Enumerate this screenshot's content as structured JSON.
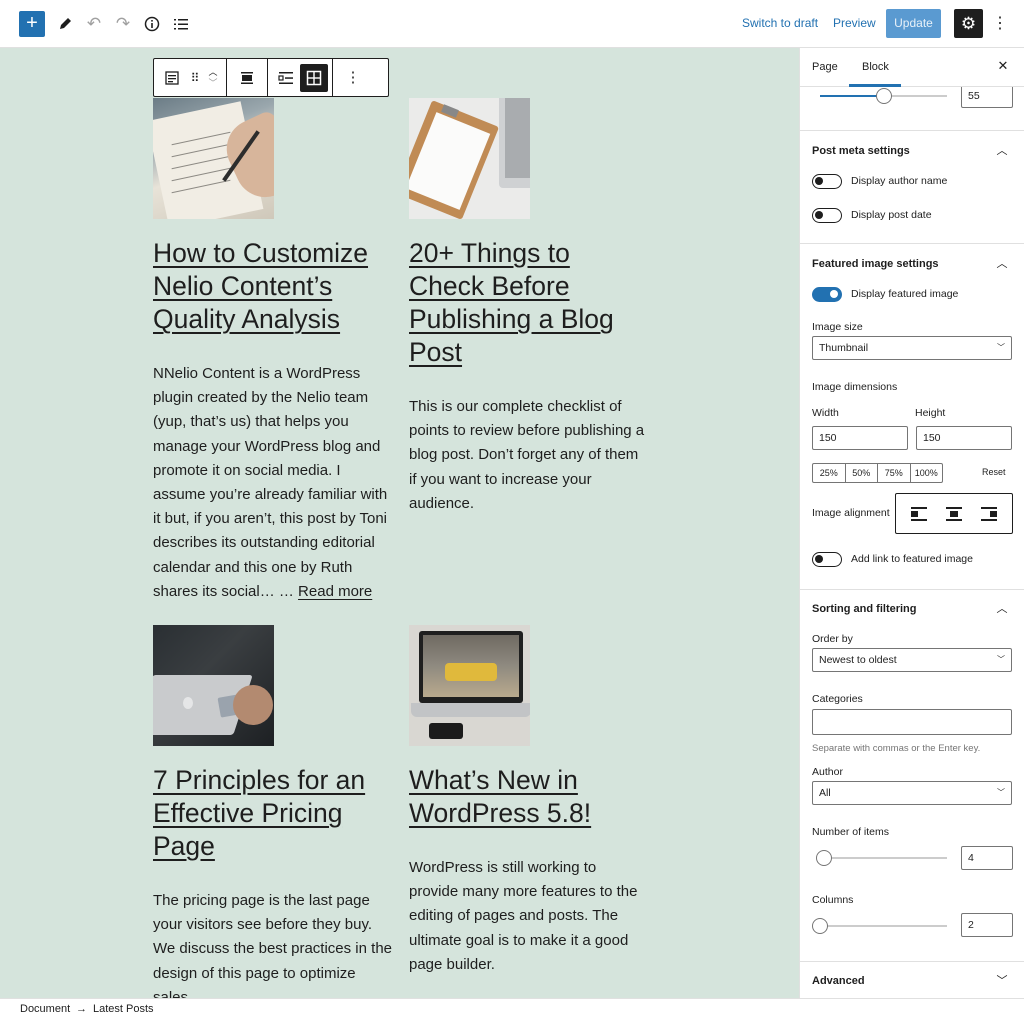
{
  "topbar": {
    "add_block_icon": "plus-icon",
    "tools_icon": "pencil-icon",
    "undo_icon": "undo-icon",
    "redo_icon": "redo-icon",
    "details_icon": "info-icon",
    "outline_icon": "list-view-icon",
    "switch_to_draft": "Switch to draft",
    "preview": "Preview",
    "update": "Update",
    "settings_icon": "gear-icon",
    "more_icon": "kebab-icon"
  },
  "block_toolbar": {
    "block_icon": "latest-posts-icon",
    "drag_icon": "drag-handle-icon",
    "move_icon": "move-up-down-icon",
    "align_icon": "align-wide-icon",
    "list_view_icon": "list-layout-icon",
    "grid_view_icon": "grid-layout-icon",
    "options_icon": "kebab-icon"
  },
  "posts": [
    {
      "title": "How to Customize Nelio Content’s Quality Analysis",
      "excerpt": "NNelio Content is a WordPress plugin created by the Nelio team (yup, that’s us) that helps you manage your WordPress blog and promote it on social media. I assume you’re already familiar with it but, if you aren’t, this post by Toni describes its outstanding editorial calendar and this one by Ruth shares its social… …",
      "read_more": "Read more"
    },
    {
      "title": "20+ Things to Check Before Publishing a Blog Post",
      "excerpt": "This is our complete checklist of points to review before publishing a blog post. Don’t forget any of them if you want to increase your audience.",
      "read_more": ""
    },
    {
      "title": "7 Principles for an Effective Pricing Page",
      "excerpt": "The pricing page is the last page your visitors see before they buy. We discuss the best practices in the design of this page to optimize sales.",
      "read_more": ""
    },
    {
      "title": "What’s New in WordPress 5.8!",
      "excerpt": "WordPress is still working to provide many more features to the editing of pages and posts. The ultimate goal is to make it a good page builder.",
      "read_more": ""
    }
  ],
  "sidebar": {
    "tabs": [
      "Page",
      "Block"
    ],
    "active_tab": "Block",
    "accent": "#2271b1",
    "top_slider_value": "55",
    "post_meta": {
      "title": "Post meta settings",
      "display_author": "Display author name",
      "display_date": "Display post date"
    },
    "featured_image": {
      "title": "Featured image settings",
      "display_featured": "Display featured image",
      "image_size_label": "Image size",
      "image_size_value": "Thumbnail",
      "dimensions_label": "Image dimensions",
      "width_label": "Width",
      "height_label": "Height",
      "width_value": "150",
      "height_value": "150",
      "percent_options": [
        "25%",
        "50%",
        "75%",
        "100%"
      ],
      "reset": "Reset",
      "alignment_label": "Image alignment",
      "add_link": "Add link to featured image"
    },
    "sorting": {
      "title": "Sorting and filtering",
      "order_by_label": "Order by",
      "order_by_value": "Newest to oldest",
      "categories_label": "Categories",
      "categories_help": "Separate with commas or the Enter key.",
      "author_label": "Author",
      "author_value": "All",
      "items_label": "Number of items",
      "items_value": "4",
      "columns_label": "Columns",
      "columns_value": "2"
    },
    "advanced": {
      "title": "Advanced"
    }
  },
  "footer": {
    "breadcrumb_root": "Document",
    "breadcrumb_current": "Latest Posts"
  }
}
